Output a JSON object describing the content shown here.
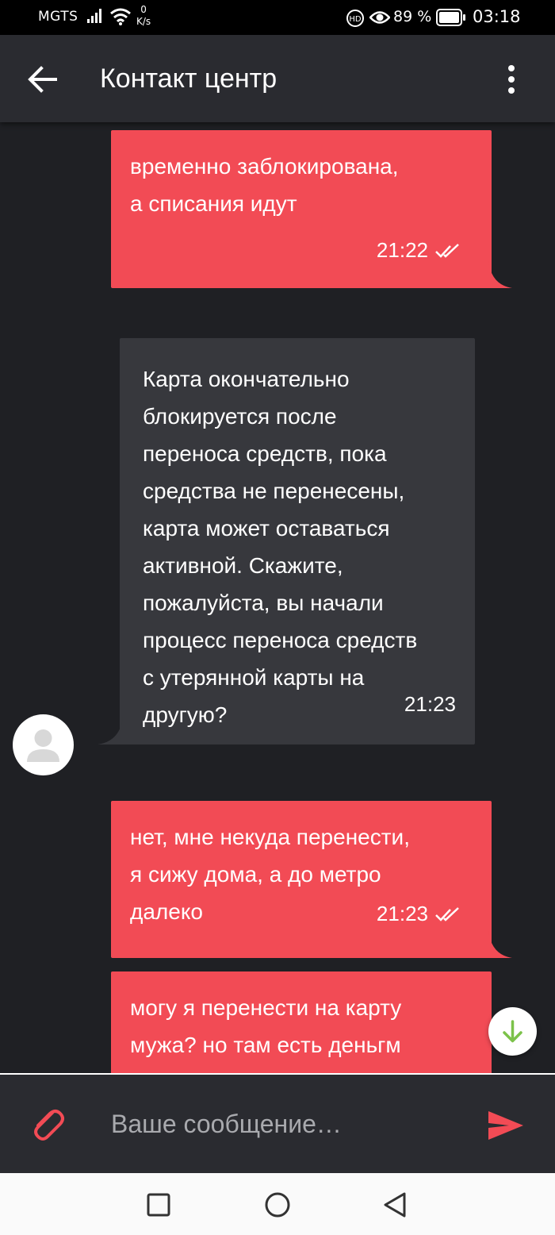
{
  "status_bar": {
    "carrier": "MGTS",
    "net_speed_value": "0",
    "net_speed_unit": "K/s",
    "battery_percent": "89 %",
    "time": "03:18",
    "icons": [
      "signal-icon",
      "wifi-icon",
      "volte-icon",
      "eye-comfort-icon",
      "battery-icon"
    ]
  },
  "header": {
    "title": "Контакт центр",
    "back_icon": "arrow-left-icon",
    "menu_icon": "more-vert-icon"
  },
  "messages": [
    {
      "direction": "outgoing",
      "lines": [
        "временно заблокирована,",
        "а списания идут"
      ],
      "time": "21:22",
      "status": "read"
    },
    {
      "direction": "incoming",
      "lines": [
        "Карта окончательно",
        "блокируется после",
        "переноса средств, пока",
        "средства не перенесены,",
        "карта может оставаться",
        "активной. Скажите,",
        "пожалуйста, вы начали",
        "процесс переноса средств",
        "с утерянной карты на",
        "другую?"
      ],
      "time": "21:23"
    },
    {
      "direction": "outgoing",
      "lines": [
        "нет, мне некуда перенести,",
        "я сижу дома, а до метро",
        "далеко"
      ],
      "time": "21:23",
      "status": "read"
    },
    {
      "direction": "outgoing",
      "lines": [
        "могу я перенести на карту",
        "мужа? но там есть деньгм"
      ]
    }
  ],
  "composer": {
    "placeholder": "Ваше сообщение…",
    "attach_icon": "paperclip-icon",
    "send_icon": "send-icon"
  },
  "colors": {
    "accent": "#f24b55",
    "background": "#1f2024",
    "incoming_bubble": "#37383d",
    "header": "#2a2b30",
    "scroll_arrow": "#7cc24a"
  },
  "nav_bar": {
    "icons": [
      "recents-square-icon",
      "home-circle-icon",
      "back-triangle-icon"
    ]
  }
}
